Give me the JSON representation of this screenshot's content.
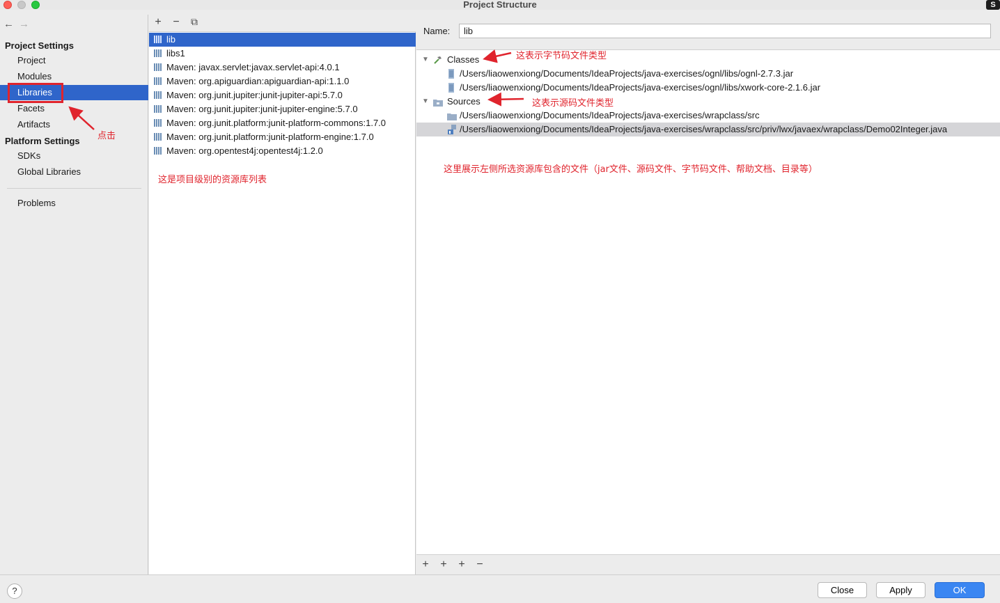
{
  "window": {
    "title": "Project Structure",
    "corner_badge": "S"
  },
  "nav": {
    "back_icon": "←",
    "forward_icon": "→"
  },
  "sidebar": {
    "project_settings_header": "Project Settings",
    "project_items": [
      "Project",
      "Modules",
      "Libraries",
      "Facets",
      "Artifacts"
    ],
    "platform_settings_header": "Platform Settings",
    "platform_items": [
      "SDKs",
      "Global Libraries"
    ],
    "problems": "Problems",
    "selected": "Libraries"
  },
  "library_toolbar": {
    "add": "+",
    "remove": "−",
    "copy": "⧉"
  },
  "libraries": [
    "lib",
    "libs1",
    "Maven: javax.servlet:javax.servlet-api:4.0.1",
    "Maven: org.apiguardian:apiguardian-api:1.1.0",
    "Maven: org.junit.jupiter:junit-jupiter-api:5.7.0",
    "Maven: org.junit.jupiter:junit-jupiter-engine:5.7.0",
    "Maven: org.junit.platform:junit-platform-commons:1.7.0",
    "Maven: org.junit.platform:junit-platform-engine:1.7.0",
    "Maven: org.opentest4j:opentest4j:1.2.0"
  ],
  "detail": {
    "name_label": "Name:",
    "name_value": "lib",
    "classes_label": "Classes",
    "classes": [
      "/Users/liaowenxiong/Documents/IdeaProjects/java-exercises/ognl/libs/ognl-2.7.3.jar",
      "/Users/liaowenxiong/Documents/IdeaProjects/java-exercises/ognl/libs/xwork-core-2.1.6.jar"
    ],
    "sources_label": "Sources",
    "sources": [
      "/Users/liaowenxiong/Documents/IdeaProjects/java-exercises/wrapclass/src",
      "/Users/liaowenxiong/Documents/IdeaProjects/java-exercises/wrapclass/src/priv/lwx/javaex/wrapclass/Demo02Integer.java"
    ],
    "toolbar": {
      "add": "+",
      "add_alt": "+",
      "add_other": "+",
      "remove": "−"
    }
  },
  "footer": {
    "help": "?",
    "close": "Close",
    "apply": "Apply",
    "ok": "OK"
  },
  "annotations": {
    "click": "点击",
    "library_list": "这是项目级别的资源库列表",
    "classes_type": "这表示字节码文件类型",
    "sources_type": "这表示源码文件类型",
    "detail_explain": "这里展示左侧所选资源库包含的文件（jar文件、源码文件、字节码文件、帮助文档、目录等）"
  },
  "colors": {
    "selection": "#2f65ca",
    "accent_button": "#3a86f2",
    "annotation": "#e0242d"
  }
}
